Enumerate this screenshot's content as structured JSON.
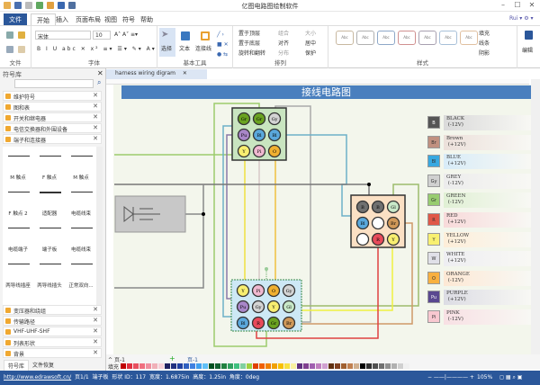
{
  "window": {
    "title": "亿图电路图绘制软件"
  },
  "menu": [
    "文件",
    "开始",
    "插入",
    "页面布局",
    "视图",
    "符号",
    "帮助"
  ],
  "ribbon": {
    "groups": [
      "文件",
      "字体",
      "基本工具",
      "排列",
      "样式",
      "编辑"
    ],
    "font_name": "宋体",
    "font_size": "10",
    "tools": [
      "选择",
      "文本",
      "连接线"
    ],
    "arrange": [
      "置于顶层",
      "置于底层",
      "旋转和翻转",
      "组合",
      "对齐",
      "分布",
      "大小",
      "居中",
      "保护"
    ],
    "format": [
      "填充",
      "线条",
      "阴影"
    ],
    "edit": "编辑",
    "style_colors": [
      "#c8b8a0",
      "#b0b0b0",
      "#8ea8c8",
      "#d09090",
      "#a8a0b0",
      "#a8c0d8",
      "#e0c0a0"
    ],
    "style_label": "Abc"
  },
  "library": {
    "title": "符号库",
    "search_placeholder": "",
    "top_categories": [
      "维护符号",
      "图和表",
      "开关和继电器",
      "电信交换器和外围设备",
      "端子和连接器"
    ],
    "shapes": [
      "M 触点",
      "F 触点",
      "M 触点",
      "F 触点 2",
      "适配器",
      "电缆线束",
      "电缆端子",
      "端子板",
      "电缆线束",
      "两导线插座",
      "两导线插头",
      "正常双向..."
    ],
    "bottom_categories": [
      "变压器和绕组",
      "传输路径",
      "VHF-UHF-SHF",
      "列表形状",
      "背景"
    ],
    "tabs": [
      "符号库",
      "文件恢复"
    ]
  },
  "document": {
    "tab": "harness wiring digram",
    "title": "接线电路图"
  },
  "connectors": {
    "c1": [
      "Gr",
      "Gr",
      "Gy",
      "Pu",
      "Bl",
      "Bl",
      "Y",
      "Pi",
      "O"
    ],
    "c2": [
      "B",
      "B",
      "Gl",
      "Bl",
      "",
      "Br",
      "",
      "R",
      "Y"
    ],
    "c3": [
      "Y",
      "Pi",
      "O",
      "Gy",
      "Pu",
      "Gy",
      "Y",
      "Gl",
      "Bl",
      "R",
      "Gr",
      "Br"
    ]
  },
  "pin_colors": {
    "Gr": "#6aa320",
    "Gy": "#d4d4d4",
    "Pu": "#a886c8",
    "Bl": "#5aa8dc",
    "Y": "#f8ee70",
    "Pi": "#f0b8d0",
    "O": "#f0b030",
    "B": "#707070",
    "Gl": "#c8e8c8",
    "Br": "#d09858",
    "R": "#e84a5a",
    "": "#ffffff"
  },
  "legend": [
    {
      "code": "B",
      "name": "BLACK",
      "volt": "(-12V)",
      "color": "#555555",
      "bg": "#dadada"
    },
    {
      "code": "Br",
      "name": "Brown",
      "volt": "(+12V)",
      "color": "#c09080",
      "bg": "#ece0da"
    },
    {
      "code": "Bl",
      "name": "BLUE",
      "volt": "(+12V)",
      "color": "#38a8e0",
      "bg": "#d8ecf8"
    },
    {
      "code": "Gy",
      "name": "GREY",
      "volt": "(-12V)",
      "color": "#d0d0d0",
      "bg": "#ececec"
    },
    {
      "code": "Gr",
      "name": "GREEN",
      "volt": "(-12V)",
      "color": "#98cc70",
      "bg": "#e0f0d4"
    },
    {
      "code": "R",
      "name": "RED",
      "volt": "(+12V)",
      "color": "#e05848",
      "bg": "#f8dada"
    },
    {
      "code": "Y",
      "name": "YELLOW",
      "volt": "(+12V)",
      "color": "#f8f070",
      "bg": "#fdeed8"
    },
    {
      "code": "W",
      "name": "WHITE",
      "volt": "(+12V)",
      "color": "#e0e0e8",
      "bg": "#eeeef2"
    },
    {
      "code": "O",
      "name": "ORANGE",
      "volt": "(-12V)",
      "color": "#f8b040",
      "bg": "#fde8d4"
    },
    {
      "code": "Pu",
      "name": "PURPLE",
      "volt": "(+12V)",
      "color": "#5a4890",
      "bg": "#dcdce4"
    },
    {
      "code": "Pi",
      "name": "PINK",
      "volt": "(-12V)",
      "color": "#f8c8d0",
      "bg": "#f8e0e4"
    }
  ],
  "pages": {
    "selector": "页-1",
    "tab": "页-1"
  },
  "fill_label": "填充",
  "palette": [
    "#c00000",
    "#e03040",
    "#e85060",
    "#f07080",
    "#f090a0",
    "#f0b0b8",
    "#f8d0d8",
    "#202060",
    "#203080",
    "#2040a0",
    "#3060c0",
    "#4080e0",
    "#40a0f0",
    "#60c0f8",
    "#005020",
    "#106030",
    "#208040",
    "#30a060",
    "#40c080",
    "#80d0a0",
    "#a0d040",
    "#e04000",
    "#f06000",
    "#f08000",
    "#f0a000",
    "#f8c000",
    "#f8e040",
    "#f8f0a0",
    "#603080",
    "#804090",
    "#a060b0",
    "#c080c0",
    "#d0a0d0",
    "#603010",
    "#804020",
    "#a06030",
    "#c08050",
    "#d0b090",
    "#000000",
    "#303030",
    "#505050",
    "#707070",
    "#909090",
    "#b0b0b0",
    "#d0d0d0",
    "#f0f0f0"
  ],
  "status": {
    "url": "http://www.edrawsoft.cn/",
    "page": "页1/1",
    "shape": "端子板",
    "id": "形状 ID：117",
    "width": "宽度：1.6875in",
    "height": "高度：1.25in",
    "angle": "角度：0deg",
    "zoom": "105%"
  }
}
